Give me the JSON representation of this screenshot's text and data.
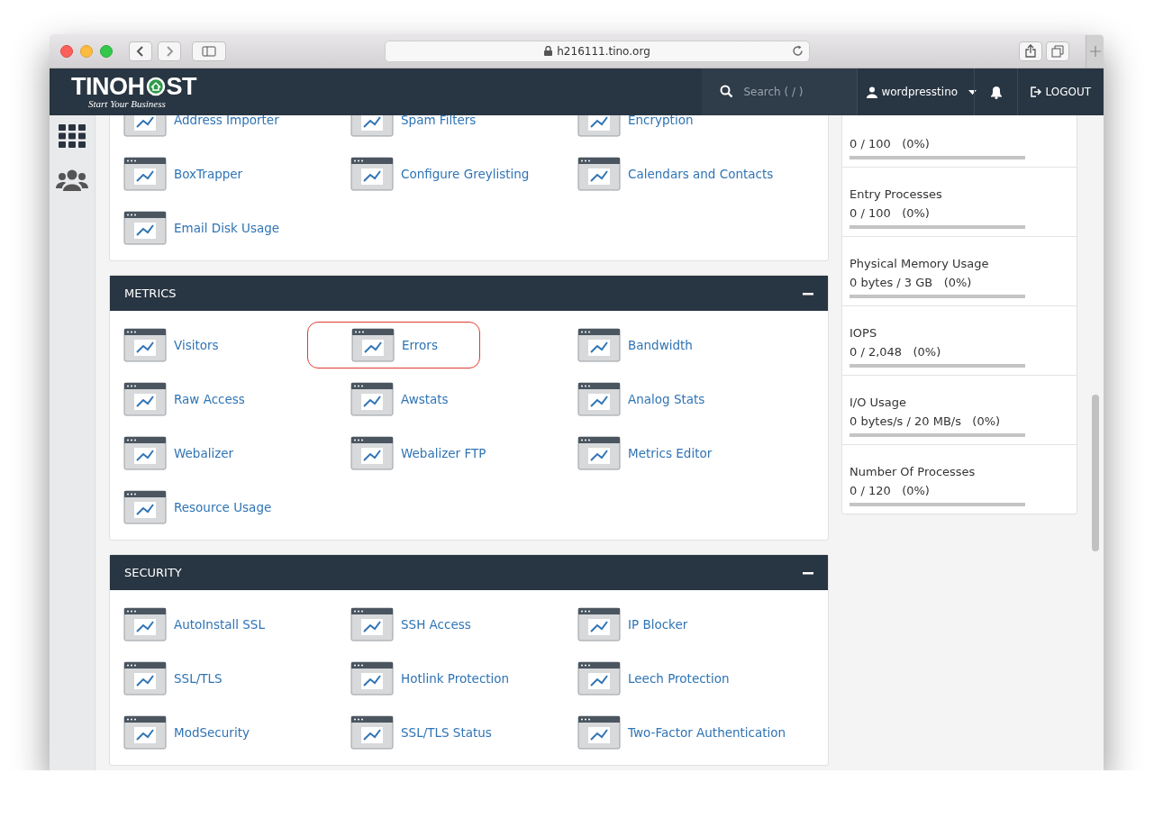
{
  "browser": {
    "url": "h216111.tino.org"
  },
  "header": {
    "logo": {
      "before": "TINOH",
      "after": "ST",
      "tagline": "Start Your Business"
    },
    "search": {
      "placeholder": "Search ( / )"
    },
    "user": "wordpresstino",
    "logout": "LOGOUT"
  },
  "sections": [
    {
      "items": [
        {
          "label": "Address Importer",
          "highlighted": false
        },
        {
          "label": "Spam Filters",
          "highlighted": false
        },
        {
          "label": "Encryption",
          "highlighted": false
        },
        {
          "label": "BoxTrapper",
          "highlighted": false
        },
        {
          "label": "Configure Greylisting",
          "highlighted": false
        },
        {
          "label": "Calendars and Contacts",
          "highlighted": false
        },
        {
          "label": "Email Disk Usage",
          "highlighted": false
        }
      ]
    },
    {
      "title": "METRICS",
      "expanded": true,
      "items": [
        {
          "label": "Visitors",
          "highlighted": false
        },
        {
          "label": "Errors",
          "highlighted": true
        },
        {
          "label": "Bandwidth",
          "highlighted": false
        },
        {
          "label": "Raw Access",
          "highlighted": false
        },
        {
          "label": "Awstats",
          "highlighted": false
        },
        {
          "label": "Analog Stats",
          "highlighted": false
        },
        {
          "label": "Webalizer",
          "highlighted": false
        },
        {
          "label": "Webalizer FTP",
          "highlighted": false
        },
        {
          "label": "Metrics Editor",
          "highlighted": false
        },
        {
          "label": "Resource Usage",
          "highlighted": false
        }
      ]
    },
    {
      "title": "SECURITY",
      "expanded": true,
      "items": [
        {
          "label": "AutoInstall SSL",
          "highlighted": false
        },
        {
          "label": "SSH Access",
          "highlighted": false
        },
        {
          "label": "IP Blocker",
          "highlighted": false
        },
        {
          "label": "SSL/TLS",
          "highlighted": false
        },
        {
          "label": "Hotlink Protection",
          "highlighted": false
        },
        {
          "label": "Leech Protection",
          "highlighted": false
        },
        {
          "label": "ModSecurity",
          "highlighted": false
        },
        {
          "label": "SSL/TLS Status",
          "highlighted": false
        },
        {
          "label": "Two-Factor Authentication",
          "highlighted": false
        }
      ]
    }
  ],
  "stats": [
    {
      "value": "0 / 100   (0%)",
      "level": 0
    },
    {
      "label": "Entry Processes",
      "value": "0 / 100   (0%)",
      "level": 0
    },
    {
      "label": "Physical Memory Usage",
      "value": "0 bytes / 3 GB   (0%)",
      "level": 0
    },
    {
      "label": "IOPS",
      "value": "0 / 2,048   (0%)",
      "level": 0
    },
    {
      "label": "I/O Usage",
      "value": "0 bytes/s / 20 MB/s   (0%)",
      "level": 0
    },
    {
      "label": "Number Of Processes",
      "value": "0 / 120   (0%)",
      "level": 0
    }
  ]
}
